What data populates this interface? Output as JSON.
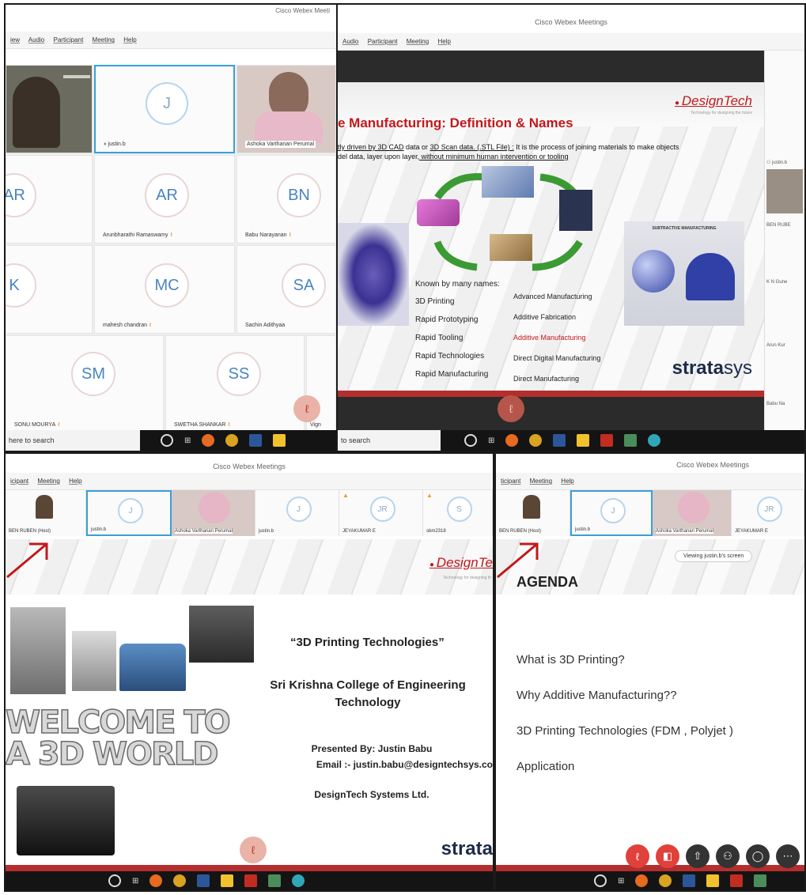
{
  "app_title": "Cisco Webex Meetings",
  "app_title_short": "Cisco Webex Meeti",
  "menus": {
    "p1": [
      "iew",
      "Audio",
      "Participant",
      "Meeting",
      "Help"
    ],
    "p2": [
      "Audio",
      "Participant",
      "Meeting",
      "Help"
    ],
    "p3": [
      "icipant",
      "Meeting",
      "Help"
    ],
    "p4": [
      "ticipant",
      "Meeting",
      "Help"
    ]
  },
  "taskbar": {
    "search1": "here to search",
    "search2": "to search"
  },
  "grid": {
    "participants": [
      {
        "initials": "J",
        "name": "justin.b"
      },
      {
        "name": "Ashoka Varthanan Perumal"
      },
      {
        "initials": "AR",
        "name": ""
      },
      {
        "initials": "AR",
        "name": "Arunbharathi Ramaswamy"
      },
      {
        "initials": "BN",
        "name": "Babu Narayanan"
      },
      {
        "initials": "K",
        "name": ""
      },
      {
        "initials": "MC",
        "name": "mahesh chandran"
      },
      {
        "initials": "SA",
        "name": "Sachin Adithyaa"
      },
      {
        "initials": "SM",
        "name": "SONU MOURYA"
      },
      {
        "initials": "SS",
        "name": "SWETHA SHANKAR"
      },
      {
        "name": "Vign"
      }
    ]
  },
  "slide1": {
    "brand": "DesignTech",
    "tagline": "Technology for designing the future",
    "title": "e Manufacturing:  Definition & Names",
    "def_part1": "tly driven by 3D CAD",
    "def_part2": " data or ",
    "def_part3": "3D Scan data. (.STL File) :",
    "def_part4": " It is the process of joining materials to make objects",
    "def_line2a": "del data, layer upon layer,",
    "def_line2b": " without minimum human intervention or tooling",
    "known_label": "Known by many names:",
    "names_left": [
      "3D Printing",
      "Rapid Prototyping",
      "Rapid Tooling",
      "Rapid Technologies",
      "Rapid Manufacturing"
    ],
    "names_right": [
      "Advanced Manufacturing",
      "Additive Fabrication",
      "Additive Manufacturing",
      "Direct Digital Manufacturing",
      "Direct Manufacturing"
    ],
    "highlight_index": 2,
    "subtractive_label": "SUBTRACTIVE MANUFACTURING",
    "brand2_a": "strata",
    "brand2_b": "sys",
    "side_names": [
      "justin.b",
      "BEN RUBE",
      "K N Gune",
      "Arun Kur",
      "Babu Na"
    ]
  },
  "strip3": {
    "names": [
      "BEN RUBEN (Host)",
      "justin.b",
      "Ashoka Varthanan Perumal",
      "justin.b",
      "JEYAKUMAR E",
      "sbm2318"
    ],
    "initials": [
      "J",
      "J",
      "JR",
      "S"
    ]
  },
  "slide3": {
    "brand": "DesignTe",
    "tagline": "Technology for designing th",
    "title": "“3D Printing Technologies”",
    "college": "Sri Krishna College of Engineering",
    "college2": "Technology",
    "presenter": "Presented By: Justin Babu",
    "email": "Email :- justin.babu@designtechsys.co",
    "company": "DesignTech Systems Ltd.",
    "welcome1": "WELCOME TO",
    "welcome2": "A 3D WORLD",
    "brand2": "strata"
  },
  "strip4": {
    "names": [
      "BEN RUBEN (Host)",
      "justin.b",
      "Ashoka Varthanan Perumal",
      "JEYAKUMAR E"
    ],
    "initials": [
      "J",
      "JR"
    ]
  },
  "slide4": {
    "viewing": "Viewing justin.b's screen",
    "title": "AGENDA",
    "items": [
      "What is 3D Printing?",
      "Why Additive Manufacturing??",
      "3D Printing Technologies (FDM , Polyjet )",
      "Application"
    ]
  }
}
